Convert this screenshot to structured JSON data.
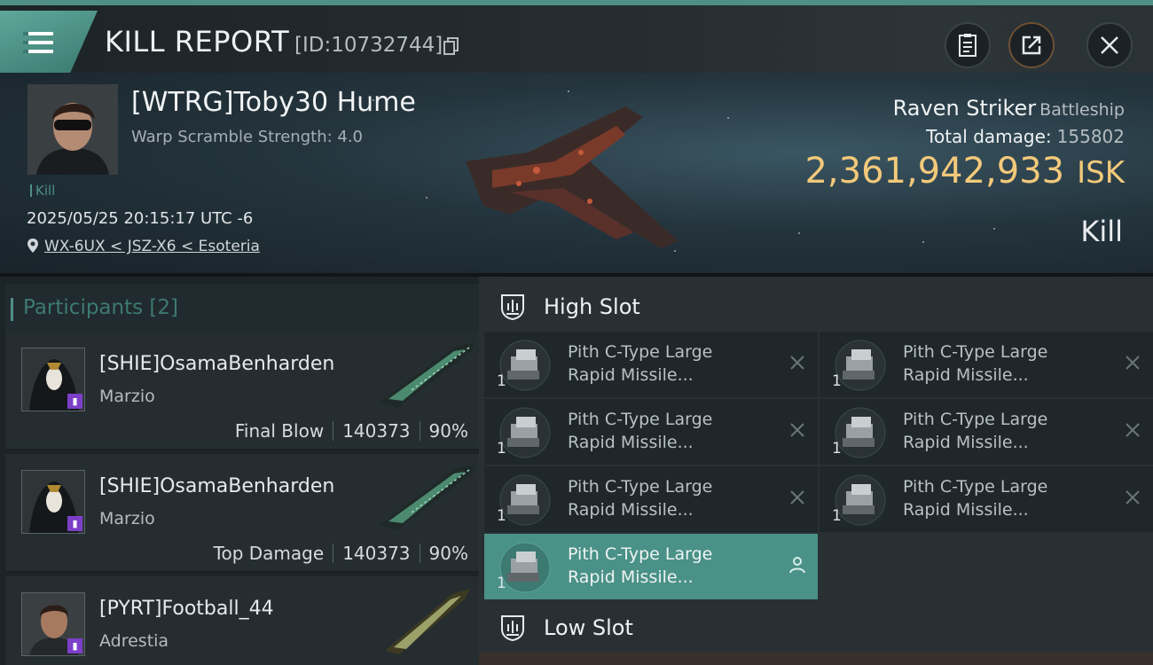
{
  "header": {
    "title": "KILL REPORT",
    "report_id": "[ID:10732744]",
    "icons": {
      "menu": "hamburger-icon",
      "copy": "copy-icon",
      "clipboard": "clipboard-icon",
      "share": "share-icon",
      "close": "close-icon"
    }
  },
  "victim": {
    "name": "[WTRG]Toby30 Hume",
    "warp_scramble": "Warp Scramble Strength: 4.0",
    "kill_tag": "Kill",
    "datetime": "2025/05/25 20:15:17 UTC -6",
    "location": "WX-6UX < JSZ-X6 < Esoteria",
    "ship_name": "Raven Striker",
    "ship_class": "Battleship",
    "total_damage_label": "Total damage:",
    "total_damage": "155802",
    "isk_value": "2,361,942,933",
    "isk_unit": "ISK",
    "result": "Kill"
  },
  "participants": {
    "label": "Participants",
    "count": "[2]",
    "items": [
      {
        "name": "[SHIE]OsamaBenharden",
        "corp": "Marzio",
        "role": "Final Blow",
        "damage": "140373",
        "percent": "90%"
      },
      {
        "name": "[SHIE]OsamaBenharden",
        "corp": "Marzio",
        "role": "Top Damage",
        "damage": "140373",
        "percent": "90%"
      },
      {
        "name": "[PYRT]Football_44",
        "corp": "Adrestia",
        "role": "",
        "damage": "",
        "percent": ""
      }
    ]
  },
  "high_slot": {
    "label": "High Slot",
    "modules": [
      {
        "line1": "Pith C-Type Large",
        "line2": "Rapid Missile...",
        "qty": "1",
        "status": "destroyed"
      },
      {
        "line1": "Pith C-Type Large",
        "line2": "Rapid Missile...",
        "qty": "1",
        "status": "destroyed"
      },
      {
        "line1": "Pith C-Type Large",
        "line2": "Rapid Missile...",
        "qty": "1",
        "status": "destroyed"
      },
      {
        "line1": "Pith C-Type Large",
        "line2": "Rapid Missile...",
        "qty": "1",
        "status": "destroyed"
      },
      {
        "line1": "Pith C-Type Large",
        "line2": "Rapid Missile...",
        "qty": "1",
        "status": "destroyed"
      },
      {
        "line1": "Pith C-Type Large",
        "line2": "Rapid Missile...",
        "qty": "1",
        "status": "destroyed"
      },
      {
        "line1": "Pith C-Type Large",
        "line2": "Rapid Missile...",
        "qty": "1",
        "status": "dropped"
      }
    ]
  },
  "low_slot": {
    "label": "Low Slot"
  },
  "colors": {
    "accent": "#4f8f86",
    "isk": "#f3c97a",
    "badge": "#7b3fc8"
  }
}
